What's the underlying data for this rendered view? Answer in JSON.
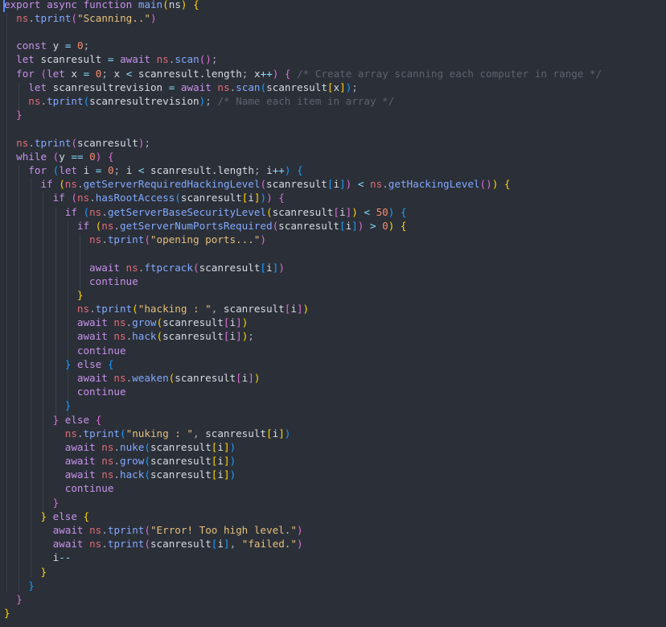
{
  "editor": {
    "background": "#2b2f38",
    "lines": [
      [
        [
          "kw",
          "export async function "
        ],
        [
          "fn",
          "main"
        ],
        [
          "b1",
          "("
        ],
        [
          "var",
          "ns"
        ],
        [
          "b1",
          ")"
        ],
        [
          "var",
          " "
        ],
        [
          "b1",
          "{"
        ]
      ],
      [
        [
          "obj",
          "ns"
        ],
        [
          "punc",
          "."
        ],
        [
          "fn",
          "tprint"
        ],
        [
          "b2",
          "("
        ],
        [
          "str",
          "\"Scanning..\""
        ],
        [
          "b2",
          ")"
        ]
      ],
      [],
      [
        [
          "kw",
          "const "
        ],
        [
          "var",
          "y "
        ],
        [
          "op",
          "="
        ],
        [
          "var",
          " "
        ],
        [
          "num",
          "0"
        ],
        [
          "punc",
          ";"
        ]
      ],
      [
        [
          "kw",
          "let "
        ],
        [
          "var",
          "scanresult "
        ],
        [
          "op",
          "="
        ],
        [
          "var",
          " "
        ],
        [
          "kw",
          "await "
        ],
        [
          "obj",
          "ns"
        ],
        [
          "punc",
          "."
        ],
        [
          "fn",
          "scan"
        ],
        [
          "b2",
          "()"
        ],
        [
          "punc",
          ";"
        ]
      ],
      [
        [
          "kw",
          "for "
        ],
        [
          "b2",
          "("
        ],
        [
          "kw",
          "let "
        ],
        [
          "var",
          "x "
        ],
        [
          "op",
          "="
        ],
        [
          "var",
          " "
        ],
        [
          "num",
          "0"
        ],
        [
          "punc",
          "; "
        ],
        [
          "var",
          "x "
        ],
        [
          "op",
          "<"
        ],
        [
          "var",
          " scanresult.length"
        ],
        [
          "punc",
          "; "
        ],
        [
          "var",
          "x"
        ],
        [
          "op",
          "++"
        ],
        [
          "b2",
          ")"
        ],
        [
          "var",
          " "
        ],
        [
          "b2",
          "{"
        ],
        [
          "com",
          " /* Create array scanning each computer in range */"
        ]
      ],
      [
        [
          "kw",
          "let "
        ],
        [
          "var",
          "scanresultrevision "
        ],
        [
          "op",
          "="
        ],
        [
          "var",
          " "
        ],
        [
          "kw",
          "await "
        ],
        [
          "obj",
          "ns"
        ],
        [
          "punc",
          "."
        ],
        [
          "fn",
          "scan"
        ],
        [
          "b3",
          "("
        ],
        [
          "var",
          "scanresult"
        ],
        [
          "b1",
          "["
        ],
        [
          "var",
          "x"
        ],
        [
          "b1",
          "]"
        ],
        [
          "b3",
          ")"
        ],
        [
          "punc",
          ";"
        ]
      ],
      [
        [
          "obj",
          "ns"
        ],
        [
          "punc",
          "."
        ],
        [
          "fn",
          "tprint"
        ],
        [
          "b3",
          "("
        ],
        [
          "var",
          "scanresultrevision"
        ],
        [
          "b3",
          ")"
        ],
        [
          "punc",
          "; "
        ],
        [
          "com",
          "/* Name each item in array */"
        ]
      ],
      [
        [
          "b2",
          "}"
        ]
      ],
      [],
      [
        [
          "obj",
          "ns"
        ],
        [
          "punc",
          "."
        ],
        [
          "fn",
          "tprint"
        ],
        [
          "b2",
          "("
        ],
        [
          "var",
          "scanresult"
        ],
        [
          "b2",
          ")"
        ],
        [
          "punc",
          ";"
        ]
      ],
      [
        [
          "kw",
          "while "
        ],
        [
          "b2",
          "("
        ],
        [
          "var",
          "y "
        ],
        [
          "op",
          "=="
        ],
        [
          "var",
          " "
        ],
        [
          "num",
          "0"
        ],
        [
          "b2",
          ")"
        ],
        [
          "var",
          " "
        ],
        [
          "b2",
          "{"
        ]
      ],
      [
        [
          "kw",
          "for "
        ],
        [
          "b3",
          "("
        ],
        [
          "kw",
          "let "
        ],
        [
          "var",
          "i "
        ],
        [
          "op",
          "="
        ],
        [
          "var",
          " "
        ],
        [
          "num",
          "0"
        ],
        [
          "punc",
          "; "
        ],
        [
          "var",
          "i "
        ],
        [
          "op",
          "<"
        ],
        [
          "var",
          " scanresult.length"
        ],
        [
          "punc",
          "; "
        ],
        [
          "var",
          "i"
        ],
        [
          "op",
          "++"
        ],
        [
          "b3",
          ")"
        ],
        [
          "var",
          " "
        ],
        [
          "b3",
          "{"
        ]
      ],
      [
        [
          "kw",
          "if "
        ],
        [
          "b1",
          "("
        ],
        [
          "obj",
          "ns"
        ],
        [
          "punc",
          "."
        ],
        [
          "fn",
          "getServerRequiredHackingLevel"
        ],
        [
          "b2",
          "("
        ],
        [
          "var",
          "scanresult"
        ],
        [
          "b3",
          "["
        ],
        [
          "var",
          "i"
        ],
        [
          "b3",
          "]"
        ],
        [
          "b2",
          ")"
        ],
        [
          "var",
          " "
        ],
        [
          "op",
          "<"
        ],
        [
          "var",
          " "
        ],
        [
          "obj",
          "ns"
        ],
        [
          "punc",
          "."
        ],
        [
          "fn",
          "getHackingLevel"
        ],
        [
          "b2",
          "()"
        ],
        [
          "b1",
          ")"
        ],
        [
          "var",
          " "
        ],
        [
          "b1",
          "{"
        ]
      ],
      [
        [
          "kw",
          "if "
        ],
        [
          "b2",
          "("
        ],
        [
          "obj",
          "ns"
        ],
        [
          "punc",
          "."
        ],
        [
          "fn",
          "hasRootAccess"
        ],
        [
          "b3",
          "("
        ],
        [
          "var",
          "scanresult"
        ],
        [
          "b1",
          "["
        ],
        [
          "var",
          "i"
        ],
        [
          "b1",
          "]"
        ],
        [
          "b3",
          ")"
        ],
        [
          "b2",
          ")"
        ],
        [
          "var",
          " "
        ],
        [
          "b2",
          "{"
        ]
      ],
      [
        [
          "kw",
          "if "
        ],
        [
          "b3",
          "("
        ],
        [
          "obj",
          "ns"
        ],
        [
          "punc",
          "."
        ],
        [
          "fn",
          "getServerBaseSecurityLevel"
        ],
        [
          "b1",
          "("
        ],
        [
          "var",
          "scanresult"
        ],
        [
          "b2",
          "["
        ],
        [
          "var",
          "i"
        ],
        [
          "b2",
          "]"
        ],
        [
          "b1",
          ")"
        ],
        [
          "var",
          " "
        ],
        [
          "op",
          "<"
        ],
        [
          "var",
          " "
        ],
        [
          "num",
          "50"
        ],
        [
          "b3",
          ")"
        ],
        [
          "var",
          " "
        ],
        [
          "b3",
          "{"
        ]
      ],
      [
        [
          "kw",
          "if "
        ],
        [
          "b1",
          "("
        ],
        [
          "obj",
          "ns"
        ],
        [
          "punc",
          "."
        ],
        [
          "fn",
          "getServerNumPortsRequired"
        ],
        [
          "b2",
          "("
        ],
        [
          "var",
          "scanresult"
        ],
        [
          "b3",
          "["
        ],
        [
          "var",
          "i"
        ],
        [
          "b3",
          "]"
        ],
        [
          "b2",
          ")"
        ],
        [
          "var",
          " "
        ],
        [
          "op",
          ">"
        ],
        [
          "var",
          " "
        ],
        [
          "num",
          "0"
        ],
        [
          "b1",
          ")"
        ],
        [
          "var",
          " "
        ],
        [
          "b1",
          "{"
        ]
      ],
      [
        [
          "obj",
          "ns"
        ],
        [
          "punc",
          "."
        ],
        [
          "fn",
          "tprint"
        ],
        [
          "b2",
          "("
        ],
        [
          "str",
          "\"opening ports...\""
        ],
        [
          "b2",
          ")"
        ]
      ],
      [],
      [
        [
          "kw",
          "await "
        ],
        [
          "obj",
          "ns"
        ],
        [
          "punc",
          "."
        ],
        [
          "fn",
          "ftpcrack"
        ],
        [
          "b2",
          "("
        ],
        [
          "var",
          "scanresult"
        ],
        [
          "b3",
          "["
        ],
        [
          "var",
          "i"
        ],
        [
          "b3",
          "]"
        ],
        [
          "b2",
          ")"
        ]
      ],
      [
        [
          "kw",
          "continue"
        ]
      ],
      [
        [
          "b1",
          "}"
        ]
      ],
      [
        [
          "obj",
          "ns"
        ],
        [
          "punc",
          "."
        ],
        [
          "fn",
          "tprint"
        ],
        [
          "b1",
          "("
        ],
        [
          "str",
          "\"hacking : \""
        ],
        [
          "punc",
          ", "
        ],
        [
          "var",
          "scanresult"
        ],
        [
          "b2",
          "["
        ],
        [
          "var",
          "i"
        ],
        [
          "b2",
          "]"
        ],
        [
          "b1",
          ")"
        ]
      ],
      [
        [
          "kw",
          "await "
        ],
        [
          "obj",
          "ns"
        ],
        [
          "punc",
          "."
        ],
        [
          "fn",
          "grow"
        ],
        [
          "b1",
          "("
        ],
        [
          "var",
          "scanresult"
        ],
        [
          "b2",
          "["
        ],
        [
          "var",
          "i"
        ],
        [
          "b2",
          "]"
        ],
        [
          "b1",
          ")"
        ]
      ],
      [
        [
          "kw",
          "await "
        ],
        [
          "obj",
          "ns"
        ],
        [
          "punc",
          "."
        ],
        [
          "fn",
          "hack"
        ],
        [
          "b1",
          "("
        ],
        [
          "var",
          "scanresult"
        ],
        [
          "b2",
          "["
        ],
        [
          "var",
          "i"
        ],
        [
          "b2",
          "]"
        ],
        [
          "b1",
          ")"
        ],
        [
          "punc",
          ";"
        ]
      ],
      [
        [
          "kw",
          "continue"
        ]
      ],
      [
        [
          "b3",
          "}"
        ],
        [
          "kw",
          " else "
        ],
        [
          "b3",
          "{"
        ]
      ],
      [
        [
          "kw",
          "await "
        ],
        [
          "obj",
          "ns"
        ],
        [
          "punc",
          "."
        ],
        [
          "fn",
          "weaken"
        ],
        [
          "b1",
          "("
        ],
        [
          "var",
          "scanresult"
        ],
        [
          "b2",
          "["
        ],
        [
          "var",
          "i"
        ],
        [
          "b2",
          "]"
        ],
        [
          "b1",
          ")"
        ]
      ],
      [
        [
          "kw",
          "continue"
        ]
      ],
      [
        [
          "b3",
          "}"
        ]
      ],
      [
        [
          "b2",
          "}"
        ],
        [
          "kw",
          " else "
        ],
        [
          "b2",
          "{"
        ]
      ],
      [
        [
          "obj",
          "ns"
        ],
        [
          "punc",
          "."
        ],
        [
          "fn",
          "tprint"
        ],
        [
          "b3",
          "("
        ],
        [
          "str",
          "\"nuking : \""
        ],
        [
          "punc",
          ", "
        ],
        [
          "var",
          "scanresult"
        ],
        [
          "b1",
          "["
        ],
        [
          "var",
          "i"
        ],
        [
          "b1",
          "]"
        ],
        [
          "b3",
          ")"
        ]
      ],
      [
        [
          "kw",
          "await "
        ],
        [
          "obj",
          "ns"
        ],
        [
          "punc",
          "."
        ],
        [
          "fn",
          "nuke"
        ],
        [
          "b3",
          "("
        ],
        [
          "var",
          "scanresult"
        ],
        [
          "b1",
          "["
        ],
        [
          "var",
          "i"
        ],
        [
          "b1",
          "]"
        ],
        [
          "b3",
          ")"
        ]
      ],
      [
        [
          "kw",
          "await "
        ],
        [
          "obj",
          "ns"
        ],
        [
          "punc",
          "."
        ],
        [
          "fn",
          "grow"
        ],
        [
          "b3",
          "("
        ],
        [
          "var",
          "scanresult"
        ],
        [
          "b1",
          "["
        ],
        [
          "var",
          "i"
        ],
        [
          "b1",
          "]"
        ],
        [
          "b3",
          ")"
        ]
      ],
      [
        [
          "kw",
          "await "
        ],
        [
          "obj",
          "ns"
        ],
        [
          "punc",
          "."
        ],
        [
          "fn",
          "hack"
        ],
        [
          "b3",
          "("
        ],
        [
          "var",
          "scanresult"
        ],
        [
          "b1",
          "["
        ],
        [
          "var",
          "i"
        ],
        [
          "b1",
          "]"
        ],
        [
          "b3",
          ")"
        ]
      ],
      [
        [
          "kw",
          "continue"
        ]
      ],
      [
        [
          "b2",
          "}"
        ]
      ],
      [
        [
          "b1",
          "}"
        ],
        [
          "kw",
          " else "
        ],
        [
          "b1",
          "{"
        ]
      ],
      [
        [
          "kw",
          "await "
        ],
        [
          "obj",
          "ns"
        ],
        [
          "punc",
          "."
        ],
        [
          "fn",
          "tprint"
        ],
        [
          "b2",
          "("
        ],
        [
          "str",
          "\"Error! Too high level.\""
        ],
        [
          "b2",
          ")"
        ]
      ],
      [
        [
          "kw",
          "await "
        ],
        [
          "obj",
          "ns"
        ],
        [
          "punc",
          "."
        ],
        [
          "fn",
          "tprint"
        ],
        [
          "b2",
          "("
        ],
        [
          "var",
          "scanresult"
        ],
        [
          "b3",
          "["
        ],
        [
          "var",
          "i"
        ],
        [
          "b3",
          "]"
        ],
        [
          "punc",
          ", "
        ],
        [
          "str",
          "\"failed.\""
        ],
        [
          "b2",
          ")"
        ]
      ],
      [
        [
          "var",
          "i"
        ],
        [
          "op",
          "--"
        ]
      ],
      [
        [
          "b1",
          "}"
        ]
      ],
      [
        [
          "b3",
          "}"
        ]
      ],
      [
        [
          "b2",
          "}"
        ]
      ],
      [
        [
          "b1",
          "}"
        ]
      ]
    ]
  }
}
